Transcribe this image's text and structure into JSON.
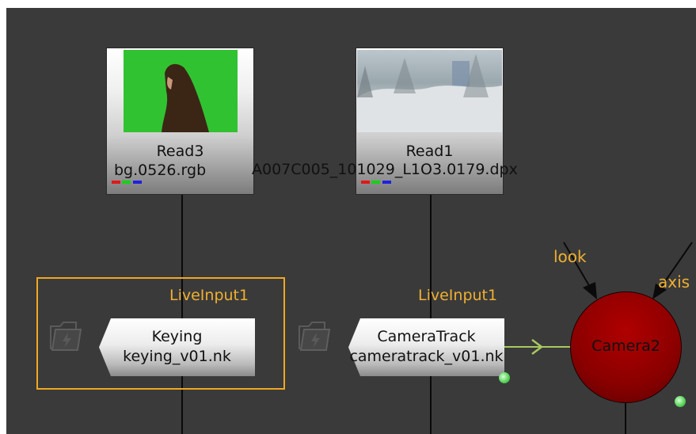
{
  "read_nodes": [
    {
      "title": "Read3",
      "file": "bg.0526.rgb"
    },
    {
      "title": "Read1",
      "file": "A007C005_101029_L1O3.0179.dpx"
    }
  ],
  "live_inputs": [
    {
      "label": "LiveInput1",
      "name": "Keying",
      "file": "keying_v01.nk",
      "selected": true
    },
    {
      "label": "LiveInput1",
      "name": "CameraTrack",
      "file": "cameratrack_v01.nk",
      "selected": false
    }
  ],
  "camera": {
    "name": "Camera2",
    "inputs": [
      "look",
      "axis"
    ]
  },
  "colors": {
    "background": "#3a3a3a",
    "selection": "#f0a820",
    "label": "#f0b030",
    "camera_fill": "#9a0000",
    "connection": "#a8c860",
    "dot": "#5cd65c"
  },
  "icons": [
    "folder-icon",
    "lightning-icon",
    "arrow-right-icon",
    "arrow-down-icon"
  ]
}
